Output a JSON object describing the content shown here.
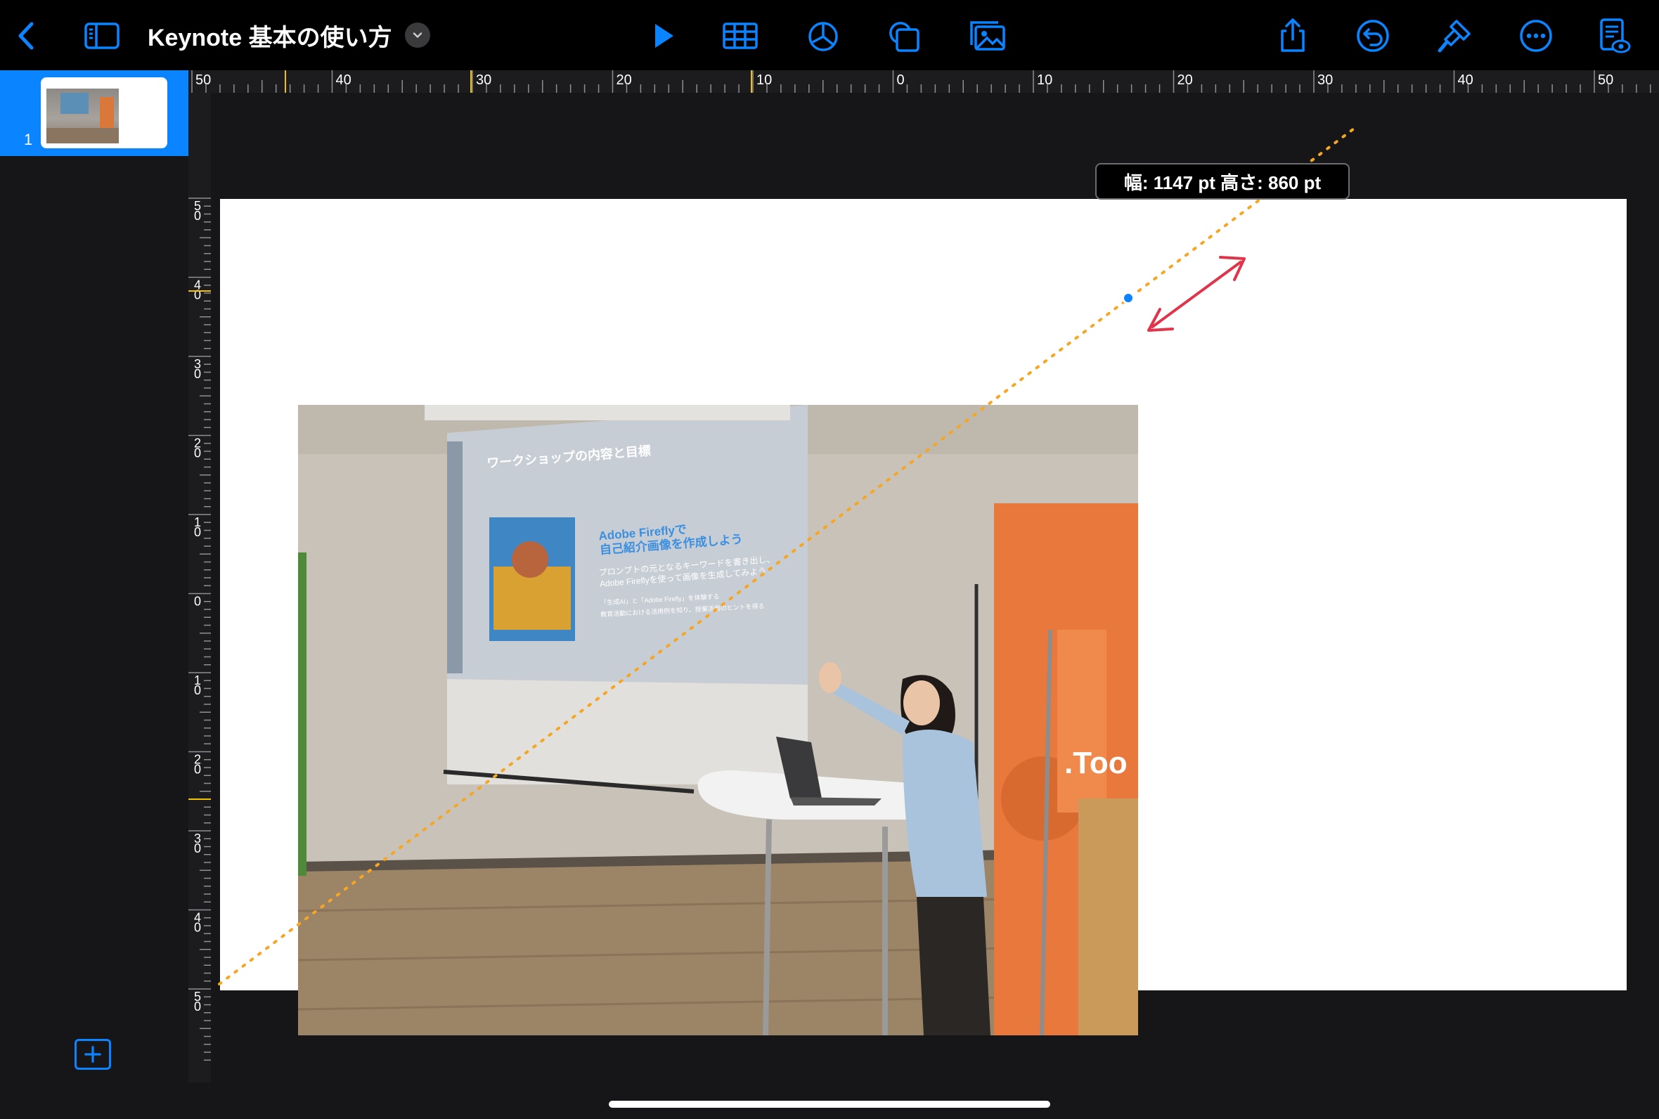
{
  "toolbar": {
    "title": "Keynote 基本の使い方",
    "buttons": [
      {
        "id": "back",
        "icon": "chevron-left-icon"
      },
      {
        "id": "sidebar",
        "icon": "sidebar-icon"
      },
      {
        "id": "play",
        "icon": "play-icon"
      },
      {
        "id": "table",
        "icon": "table-icon"
      },
      {
        "id": "chart",
        "icon": "chart-icon"
      },
      {
        "id": "shape",
        "icon": "shape-icon"
      },
      {
        "id": "media",
        "icon": "media-icon"
      },
      {
        "id": "share",
        "icon": "share-icon"
      },
      {
        "id": "undo",
        "icon": "undo-icon"
      },
      {
        "id": "format",
        "icon": "paintbrush-icon"
      },
      {
        "id": "more",
        "icon": "ellipsis-icon"
      },
      {
        "id": "reader",
        "icon": "reader-view-icon"
      }
    ],
    "accent": "#0a84ff"
  },
  "navigator": {
    "slides": [
      {
        "number": "1",
        "selected": true
      }
    ],
    "add_icon": "plus-icon"
  },
  "rulers": {
    "top_labels": [
      "50",
      "40",
      "30",
      "20",
      "10",
      "0",
      "10",
      "20",
      "30",
      "40",
      "50"
    ],
    "left_labels": [
      "5\n0",
      "4\n0",
      "3\n0",
      "2\n0",
      "1\n0",
      "0",
      "1\n0",
      "2\n0",
      "3\n0",
      "4\n0",
      "5\n0"
    ]
  },
  "canvas": {
    "size_tooltip": "幅: 1147 pt  高さ: 860 pt",
    "guide_color": "#f5a623",
    "arrow_color": "#e0344a",
    "photo": {
      "slide_title": "ワークショップの内容と目標",
      "slide_heading": "Adobe Fireflyで\n自己紹介画像を作成しよう",
      "slide_body": "プロンプトの元となるキーワードを書き出し、\nAdobe Fireflyを使って画像を生成してみよう",
      "slide_bullet_1": "「生成AI」と「Adobe Firefly」を体験する",
      "slide_bullet_2": "教育活動における活用例を知り、授業活用のヒントを得る",
      "banner_text": ".Too"
    }
  }
}
